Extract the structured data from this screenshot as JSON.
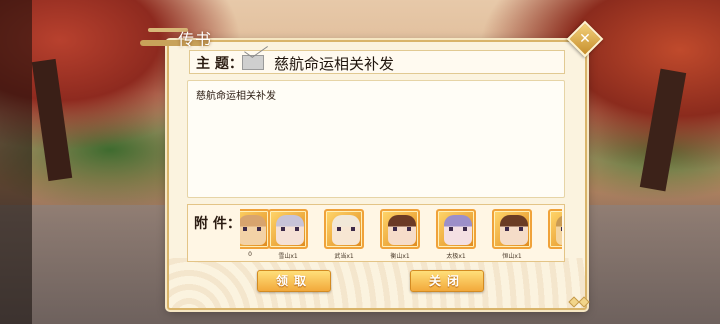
{
  "window": {
    "title": "传书",
    "close_icon": "close-icon"
  },
  "subject": {
    "label": "主 题：",
    "icon": "mail-icon",
    "text": "慈航命运相关补发"
  },
  "body": {
    "text": "慈航命运相关补发"
  },
  "attachments": {
    "label": "附 件：",
    "items": [
      {
        "name": "",
        "count": "0",
        "face": "#f3d2a6",
        "hair": "#d8a46e"
      },
      {
        "name": "雪山",
        "count": "雪山x1",
        "face": "#f5e1d6",
        "hair": "#c7c3d8"
      },
      {
        "name": "武当",
        "count": "武当x1",
        "face": "#f7e6d3",
        "hair": "#f1e8d8"
      },
      {
        "name": "衡山",
        "count": "衡山x1",
        "face": "#f6dcc9",
        "hair": "#6b3a25"
      },
      {
        "name": "太极",
        "count": "太极x1",
        "face": "#f4e0e3",
        "hair": "#9c8fc9"
      },
      {
        "name": "恒山",
        "count": "恒山x1",
        "face": "#f5dcc8",
        "hair": "#6a3c24"
      },
      {
        "name": "",
        "count": "",
        "face": "#f4d5a0",
        "hair": "#c99a52"
      }
    ]
  },
  "buttons": {
    "claim": "领取",
    "close": "关闭"
  },
  "colors": {
    "accent": "#f2a93b",
    "border": "#d9b46a",
    "paper": "#fbf3df"
  }
}
